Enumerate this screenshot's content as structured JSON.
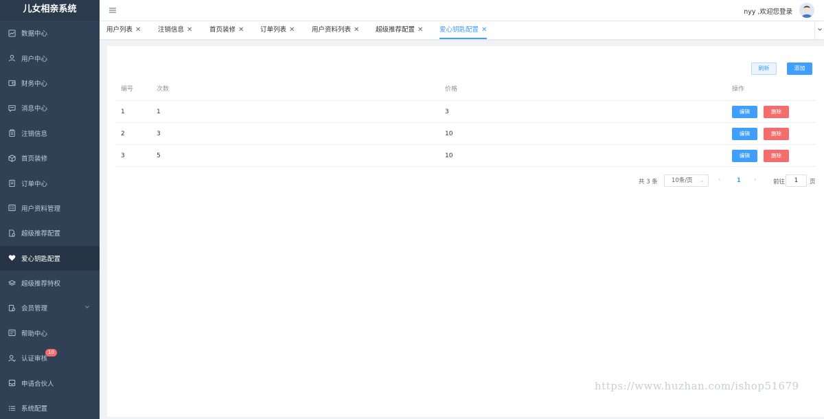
{
  "app_title": "儿女相亲系统",
  "sidebar": {
    "items": [
      {
        "label": "数据中心",
        "icon": "chart-icon"
      },
      {
        "label": "用户中心",
        "icon": "user-icon"
      },
      {
        "label": "财务中心",
        "icon": "wallet-icon"
      },
      {
        "label": "消息中心",
        "icon": "message-icon"
      },
      {
        "label": "注销信息",
        "icon": "clipboard-icon"
      },
      {
        "label": "首页装修",
        "icon": "box-icon"
      },
      {
        "label": "订单中心",
        "icon": "order-icon"
      },
      {
        "label": "用户资料管理",
        "icon": "profile-list-icon"
      },
      {
        "label": "超级推荐配置",
        "icon": "doc-gear-icon"
      },
      {
        "label": "爱心钥匙配置",
        "icon": "heart-icon",
        "active": true
      },
      {
        "label": "超级推荐特权",
        "icon": "layers-icon"
      },
      {
        "label": "会员管理",
        "icon": "member-icon",
        "has_children": true
      },
      {
        "label": "帮助中心",
        "icon": "help-icon"
      },
      {
        "label": "认证审核",
        "icon": "verify-user-icon",
        "badge": "10"
      },
      {
        "label": "申请合伙人",
        "icon": "inbox-icon"
      },
      {
        "label": "系统配置",
        "icon": "list-icon"
      }
    ]
  },
  "topbar": {
    "greeting": "nyy ,欢迎您登录"
  },
  "tags": [
    {
      "label": "用户列表"
    },
    {
      "label": "注销信息"
    },
    {
      "label": "首页装修"
    },
    {
      "label": "订单列表"
    },
    {
      "label": "用户资料列表"
    },
    {
      "label": "超级推荐配置"
    },
    {
      "label": "爱心钥匙配置",
      "active": true
    }
  ],
  "toolbar": {
    "refresh_label": "刷新",
    "add_label": "添加"
  },
  "table": {
    "headers": [
      "编号",
      "次数",
      "价格",
      "操作"
    ],
    "rows": [
      {
        "id": "1",
        "count": "1",
        "price": "3"
      },
      {
        "id": "2",
        "count": "3",
        "price": "10"
      },
      {
        "id": "3",
        "count": "5",
        "price": "10"
      }
    ],
    "edit_label": "编辑",
    "delete_label": "删除"
  },
  "pagination": {
    "total_text": "共 3 条",
    "page_size": "10条/页",
    "current_page": "1",
    "goto_prefix": "前往",
    "goto_value": "1",
    "goto_suffix": "页"
  },
  "watermark": "https://www.huzhan.com/ishop51679",
  "colors": {
    "sidebar_bg": "#304156",
    "primary": "#409eff",
    "danger": "#f56c6c"
  }
}
